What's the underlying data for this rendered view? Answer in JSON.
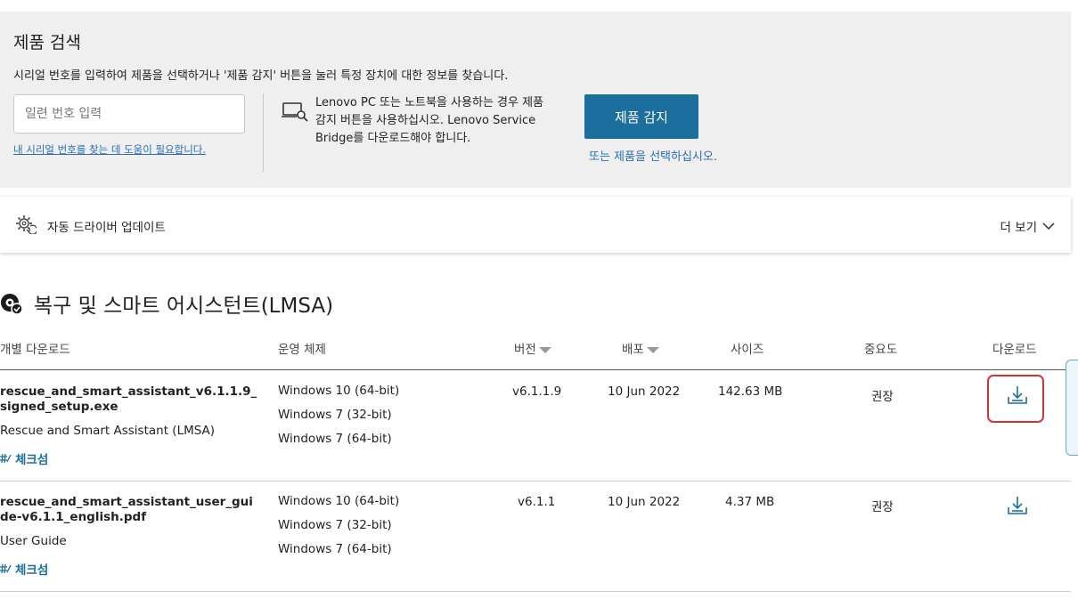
{
  "search": {
    "title": "제품 검색",
    "description": "시리얼 번호를 입력하여 제품을 선택하거나 '제품 감지' 버튼을 눌러 특정 장치에 대한 정보를 찾습니다.",
    "serial_placeholder": "일련 번호 입력",
    "help_link": "내 시리얼 번호를 찾는 데 도움이 필요합니다.",
    "lsb_text": "Lenovo PC 또는 노트북을 사용하는 경우 제품 감지 버튼을 사용하십시오. Lenovo Service Bridge를 다운로드해야 합니다.",
    "detect_button": "제품 감지",
    "select_link": "또는 제품을 선택하십시오."
  },
  "driver_bar": {
    "label": "자동 드라이버 업데이트",
    "more": "더 보기"
  },
  "product": {
    "title": "복구 및 스마트 어시스턴트(LMSA)"
  },
  "table": {
    "headers": {
      "download_item": "개별 다운로드",
      "os": "운영 체제",
      "version": "버전",
      "release": "배포",
      "size": "사이즈",
      "priority": "중요도",
      "download": "다운로드"
    },
    "rows": [
      {
        "file": "rescue_and_smart_assistant_v6.1.1.9_signed_setup.exe",
        "description": "Rescue and Smart Assistant (LMSA)",
        "checksum": "체크섬",
        "os": [
          "Windows 10 (64-bit)",
          "Windows 7 (32-bit)",
          "Windows 7 (64-bit)"
        ],
        "version": "v6.1.1.9",
        "date": "10 Jun 2022",
        "size": "142.63 MB",
        "priority": "권장"
      },
      {
        "file": "rescue_and_smart_assistant_user_guide-v6.1.1_english.pdf",
        "description": "User Guide",
        "checksum": "체크섬",
        "os": [
          "Windows 10 (64-bit)",
          "Windows 7 (32-bit)",
          "Windows 7 (64-bit)"
        ],
        "version": "v6.1.1",
        "date": "10 Jun 2022",
        "size": "4.37 MB",
        "priority": "권장"
      }
    ]
  },
  "colors": {
    "accent": "#1c6f9c",
    "link": "#2a6fb0",
    "panel_bg": "#efefef",
    "highlight": "#d43333"
  },
  "icons": {
    "laptop": "laptop-search-icon",
    "driver": "gear-refresh-icon",
    "chevron": "chevron-down-icon",
    "product": "lmsa-product-icon",
    "checksum": "checksum-icon",
    "download": "download-icon"
  }
}
